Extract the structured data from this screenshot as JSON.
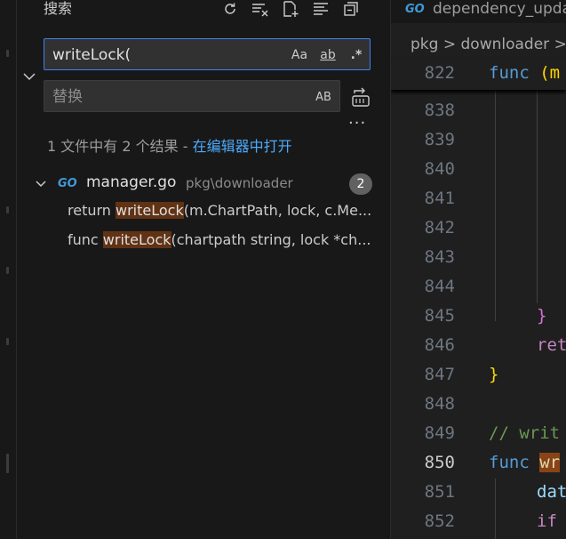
{
  "sidebar": {
    "title": "搜索",
    "actions": [
      "refresh-icon",
      "clear-results-icon",
      "new-search-editor-icon",
      "view-as-tree-icon",
      "collapse-all-icon"
    ],
    "search": {
      "value": "writeLock(",
      "match_case": "Aa",
      "whole_word": "ab",
      "regex": ".*"
    },
    "replace": {
      "placeholder": "替换",
      "preserve_case": "AB"
    },
    "more": "···",
    "summary": {
      "text": "1 文件中有 2 个结果 - ",
      "link": "在编辑器中打开"
    },
    "results": [
      {
        "file": "manager.go",
        "path": "pkg\\downloader",
        "count": "2",
        "matches": [
          {
            "before": "return ",
            "hit": "writeLock",
            "after": "(m.ChartPath, lock, c.Me..."
          },
          {
            "before": "func ",
            "hit": "writeLock",
            "after": "(chartpath string, lock *ch..."
          }
        ]
      }
    ]
  },
  "editor": {
    "tab": {
      "icon": "GO",
      "name": "dependency_upda"
    },
    "breadcrumb": {
      "part1": "pkg",
      "sep": ">",
      "part2": "downloader",
      "sep2": ">"
    },
    "sticky_line": {
      "num": "822",
      "kw": "func",
      "rest": " (m"
    },
    "lines": [
      {
        "num": "838",
        "text": ""
      },
      {
        "num": "839",
        "text": ""
      },
      {
        "num": "840",
        "text": ""
      },
      {
        "num": "841",
        "text": ""
      },
      {
        "num": "842",
        "text": ""
      },
      {
        "num": "843",
        "text": ""
      },
      {
        "num": "844",
        "text": ""
      },
      {
        "num": "845",
        "brace": "}"
      },
      {
        "num": "846",
        "kw2": "ret"
      },
      {
        "num": "847",
        "brace": "}"
      },
      {
        "num": "848",
        "text": ""
      },
      {
        "num": "849",
        "comment": "// writ"
      },
      {
        "num": "850",
        "kw": "func",
        "hl": "wr",
        "active": true
      },
      {
        "num": "851",
        "id": "dat"
      },
      {
        "num": "852",
        "kw2": "if"
      }
    ],
    "active_line": "850"
  },
  "colors": {
    "accent": "#3b82f6",
    "match_highlight": "#613214",
    "link": "#4daafc"
  }
}
